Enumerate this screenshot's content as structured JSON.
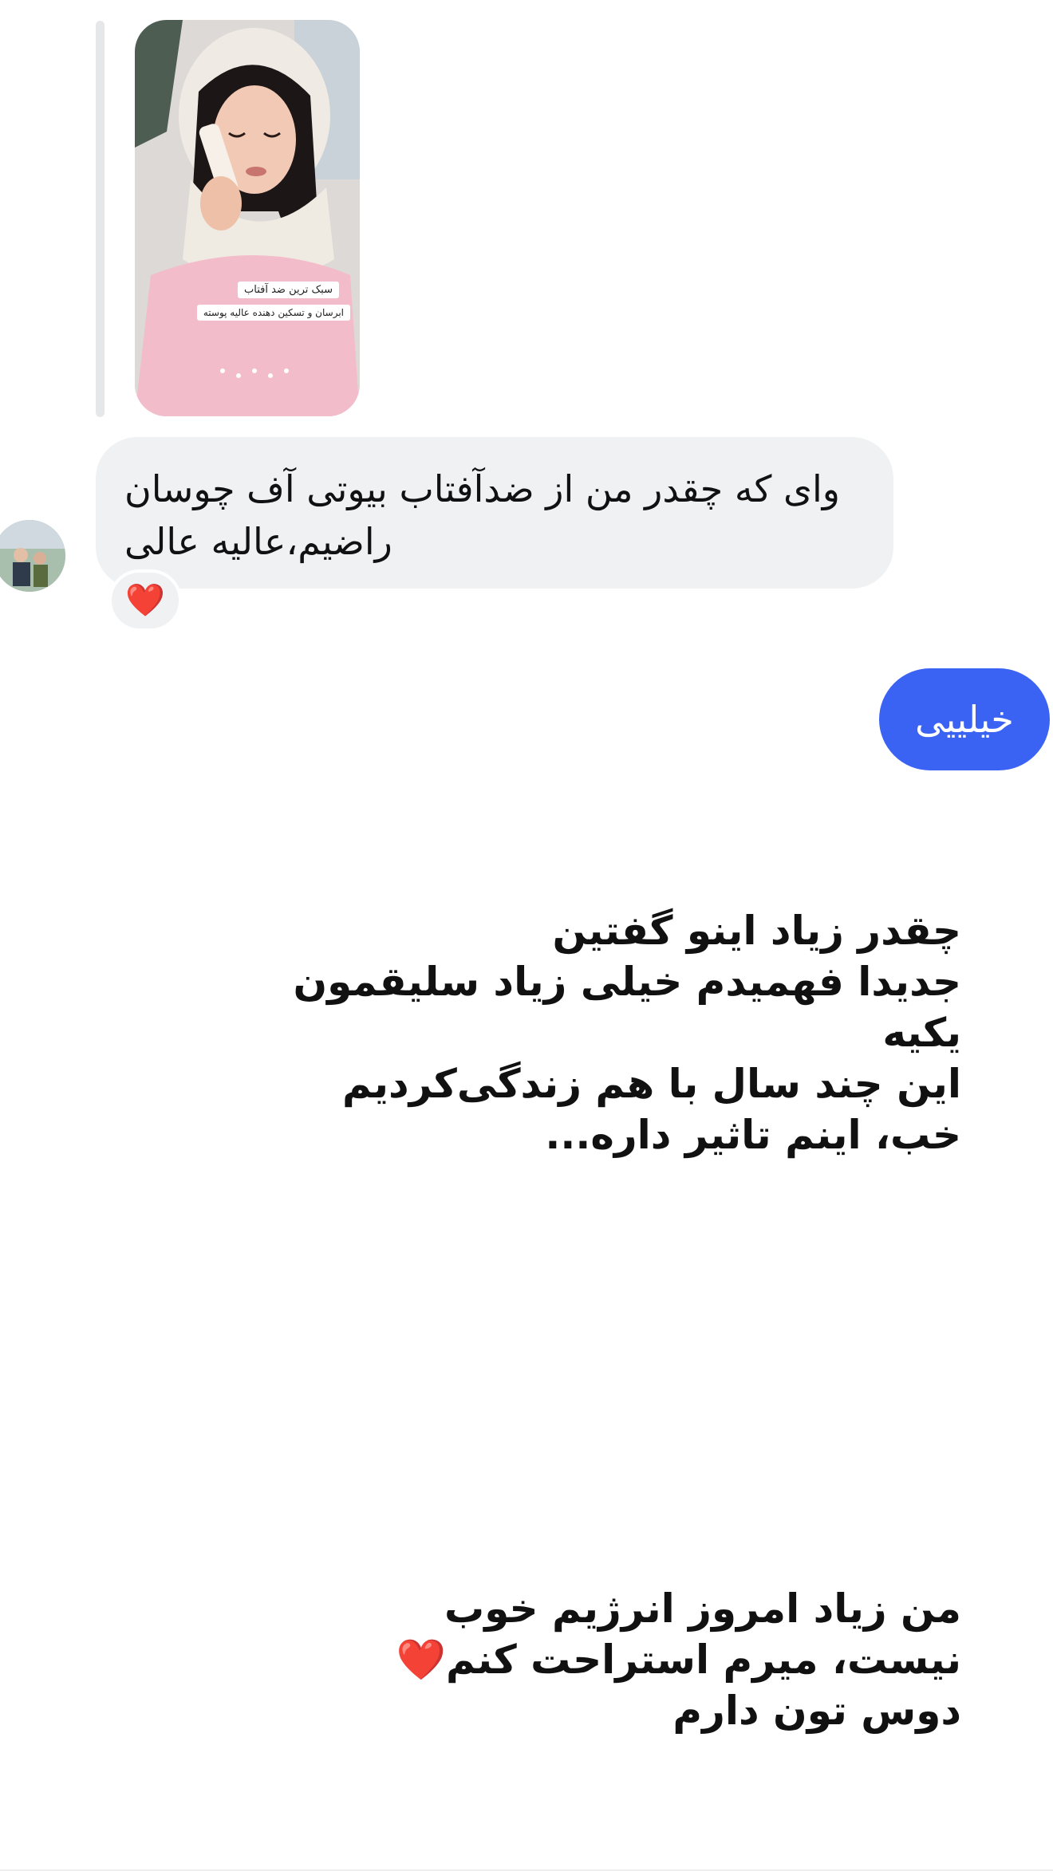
{
  "colors": {
    "outgoing_bubble": "#3b63f3",
    "incoming_bubble": "#f0f1f3",
    "reply_bar": "#e6e7e9",
    "text": "#111111",
    "heart": "#e02020"
  },
  "story_reply": {
    "sticker_1": "سبک ترین ضد آفتاب",
    "sticker_2": "ابرسان و تسکین دهنده عالیه پوسته"
  },
  "incoming_message": {
    "line_1": "وای که چقدر من از ضدآفتاب بیوتی آف چوسان",
    "line_2": "راضیم،عالیه عالی",
    "reaction_icon": "heart-icon",
    "reaction": "❤️"
  },
  "outgoing_message": {
    "text": "خیلییی"
  },
  "text_block_1": {
    "lines": [
      "چقدر زیاد اینو گفتین",
      "جدیدا فهمیدم خیلی زیاد سلیقمون",
      "یکیه",
      "این چند سال با هم زندگی‌کردیم",
      "خب، اینم تاثیر داره..."
    ]
  },
  "text_block_2": {
    "line_1": "من زیاد امروز انرژیم خوب",
    "line_2_text": "نیست، میرم استراحت کنم",
    "line_2_heart": "❤️",
    "line_3": "دوس تون دارم"
  }
}
